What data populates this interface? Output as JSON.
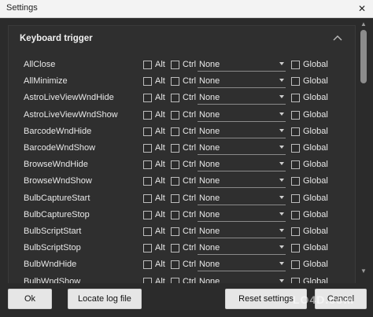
{
  "window": {
    "title": "Settings"
  },
  "section": {
    "title": "Keyboard trigger"
  },
  "columns": {
    "alt": "Alt",
    "ctrl": "Ctrl",
    "global": "Global"
  },
  "rows": [
    {
      "name": "AllClose",
      "value": "None"
    },
    {
      "name": "AllMinimize",
      "value": "None"
    },
    {
      "name": "AstroLiveViewWndHide",
      "value": "None"
    },
    {
      "name": "AstroLiveViewWndShow",
      "value": "None"
    },
    {
      "name": "BarcodeWndHide",
      "value": "None"
    },
    {
      "name": "BarcodeWndShow",
      "value": "None"
    },
    {
      "name": "BrowseWndHide",
      "value": "None"
    },
    {
      "name": "BrowseWndShow",
      "value": "None"
    },
    {
      "name": "BulbCaptureStart",
      "value": "None"
    },
    {
      "name": "BulbCaptureStop",
      "value": "None"
    },
    {
      "name": "BulbScriptStart",
      "value": "None"
    },
    {
      "name": "BulbScriptStop",
      "value": "None"
    },
    {
      "name": "BulbWndHide",
      "value": "None"
    },
    {
      "name": "BulbWndShow",
      "value": "None"
    }
  ],
  "buttons": {
    "ok": "Ok",
    "locate": "Locate log file",
    "reset": "Reset settings",
    "cancel": "Cancel"
  },
  "watermark": "LO4D.com"
}
